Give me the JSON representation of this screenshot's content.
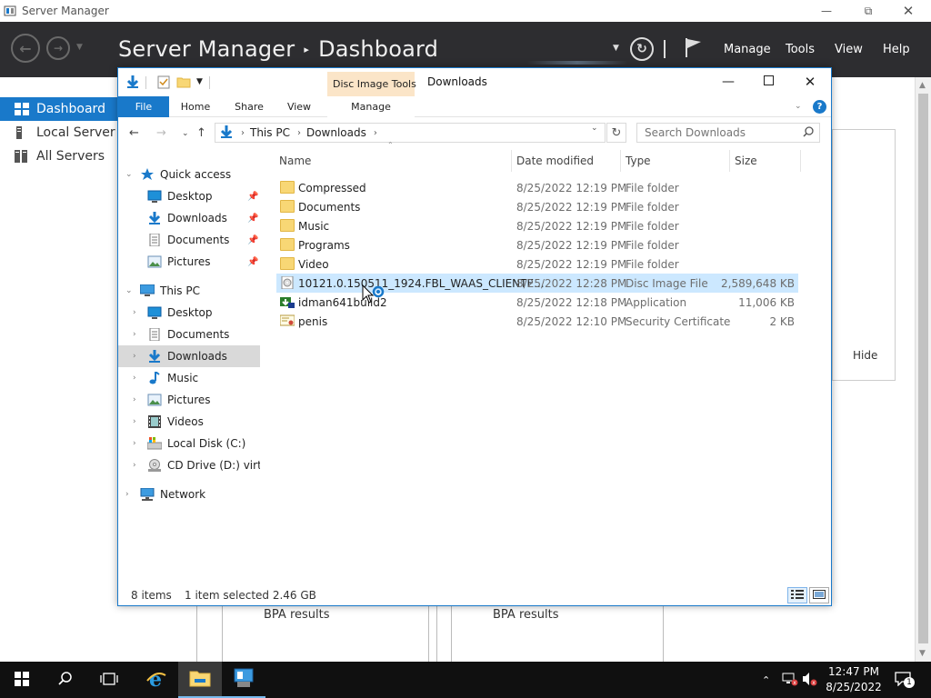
{
  "server_manager": {
    "window_title": "Server Manager",
    "breadcrumb_app": "Server Manager",
    "breadcrumb_sep": "▸",
    "breadcrumb_page": "Dashboard",
    "menu": [
      "Manage",
      "Tools",
      "View",
      "Help"
    ],
    "sidebar": [
      {
        "label": "Dashboard",
        "icon": "dashboard-icon",
        "active": true
      },
      {
        "label": "Local Server",
        "icon": "server-icon",
        "active": false
      },
      {
        "label": "All Servers",
        "icon": "servers-icon",
        "active": false
      }
    ],
    "hide_label": "Hide",
    "bpa": [
      "BPA results",
      "BPA results"
    ],
    "accent": "#1979ca",
    "header_bg": "#2d2d30"
  },
  "explorer": {
    "title": "Downloads",
    "context_tab_group": "Disc Image Tools",
    "ribbon_tabs": [
      "File",
      "Home",
      "Share",
      "View",
      "Manage"
    ],
    "address": {
      "root": "This PC",
      "folder": "Downloads"
    },
    "search_placeholder": "Search Downloads",
    "columns": {
      "name": "Name",
      "date": "Date modified",
      "type": "Type",
      "size": "Size"
    },
    "nav": [
      {
        "label": "Quick access",
        "icon": "star-icon",
        "level": 0,
        "expanded": true
      },
      {
        "label": "Desktop",
        "icon": "desktop-icon",
        "level": 1,
        "pinned": true
      },
      {
        "label": "Downloads",
        "icon": "download-arrow-icon",
        "level": 1,
        "pinned": true
      },
      {
        "label": "Documents",
        "icon": "document-icon",
        "level": 1,
        "pinned": true
      },
      {
        "label": "Pictures",
        "icon": "pictures-icon",
        "level": 1,
        "pinned": true
      },
      {
        "label": "This PC",
        "icon": "computer-icon",
        "level": 0,
        "expanded": true
      },
      {
        "label": "Desktop",
        "icon": "desktop-icon",
        "level": 1
      },
      {
        "label": "Documents",
        "icon": "document-icon",
        "level": 1
      },
      {
        "label": "Downloads",
        "icon": "download-arrow-icon",
        "level": 1,
        "selected": true
      },
      {
        "label": "Music",
        "icon": "music-icon",
        "level": 1
      },
      {
        "label": "Pictures",
        "icon": "pictures-icon",
        "level": 1
      },
      {
        "label": "Videos",
        "icon": "video-icon",
        "level": 1
      },
      {
        "label": "Local Disk (C:)",
        "icon": "drive-icon",
        "level": 1
      },
      {
        "label": "CD Drive (D:) virtio-",
        "icon": "cd-drive-icon",
        "level": 1
      },
      {
        "label": "Network",
        "icon": "network-icon",
        "level": 0
      }
    ],
    "files": [
      {
        "name": "Compressed",
        "date": "8/25/2022 12:19 PM",
        "type": "File folder",
        "size": "",
        "icon": "folder-icon"
      },
      {
        "name": "Documents",
        "date": "8/25/2022 12:19 PM",
        "type": "File folder",
        "size": "",
        "icon": "folder-icon"
      },
      {
        "name": "Music",
        "date": "8/25/2022 12:19 PM",
        "type": "File folder",
        "size": "",
        "icon": "folder-icon"
      },
      {
        "name": "Programs",
        "date": "8/25/2022 12:19 PM",
        "type": "File folder",
        "size": "",
        "icon": "folder-icon"
      },
      {
        "name": "Video",
        "date": "8/25/2022 12:19 PM",
        "type": "File folder",
        "size": "",
        "icon": "folder-icon"
      },
      {
        "name": "10121.0.150511_1924.FBL_WAAS_CLIENTE...",
        "date": "8/25/2022 12:28 PM",
        "type": "Disc Image File",
        "size": "2,589,648 KB",
        "icon": "disc-image-icon",
        "selected": true
      },
      {
        "name": "idman641build2",
        "date": "8/25/2022 12:18 PM",
        "type": "Application",
        "size": "11,006 KB",
        "icon": "application-icon"
      },
      {
        "name": "penis",
        "date": "8/25/2022 12:10 PM",
        "type": "Security Certificate",
        "size": "2 KB",
        "icon": "certificate-icon"
      }
    ],
    "status": {
      "count": "8 items",
      "selection": "1 item selected  2.46 GB"
    }
  },
  "taskbar": {
    "time": "12:47 PM",
    "date": "8/25/2022",
    "notification_count": "1"
  }
}
